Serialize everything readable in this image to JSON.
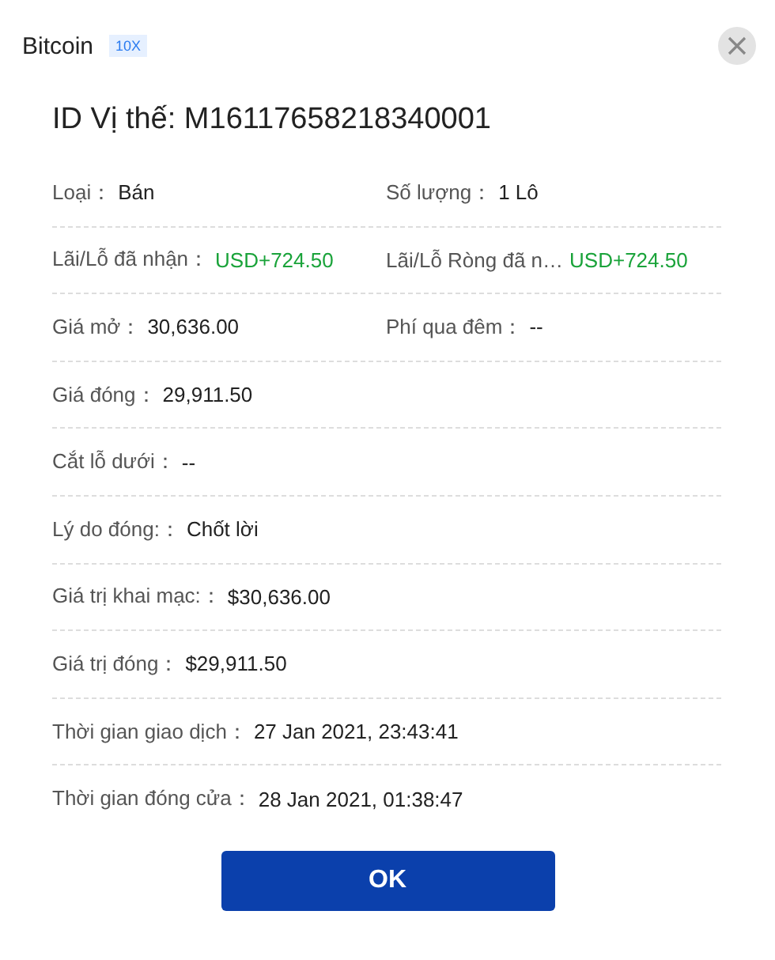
{
  "header": {
    "title": "Bitcoin",
    "badge": "10X"
  },
  "position_id": "ID Vị thế: M16117658218340001",
  "rows": [
    [
      {
        "label": "Loại：",
        "value": "Bán",
        "positive": false
      },
      {
        "label": "Số lượng：",
        "value": "1 Lô",
        "positive": false
      }
    ],
    [
      {
        "label": "Lãi/Lỗ đã nhận：",
        "value": "USD+724.50",
        "positive": true
      },
      {
        "label": "Lãi/Lỗ Ròng đã n…",
        "value": "USD+724.50",
        "positive": true
      }
    ],
    [
      {
        "label": "Giá mở：",
        "value": "30,636.00",
        "positive": false
      },
      {
        "label": "Phí qua đêm：",
        "value": "--",
        "positive": false
      }
    ],
    [
      {
        "label": "Giá đóng：",
        "value": "29,911.50",
        "positive": false
      }
    ],
    [
      {
        "label": "Cắt lỗ dưới：",
        "value": "--",
        "positive": false
      }
    ],
    [
      {
        "label": "Lý do đóng:：",
        "value": "Chốt lời",
        "positive": false
      }
    ],
    [
      {
        "label": "Giá trị khai mạc:：",
        "value": "$30,636.00",
        "positive": false
      }
    ],
    [
      {
        "label": "Giá trị đóng：",
        "value": "$29,911.50",
        "positive": false
      }
    ],
    [
      {
        "label": "Thời gian giao dịch：",
        "value": "27 Jan 2021, 23:43:41",
        "positive": false
      }
    ],
    [
      {
        "label": "Thời gian đóng cửa：",
        "value": "28 Jan 2021, 01:38:47",
        "positive": false
      }
    ]
  ],
  "ok_button": "OK"
}
